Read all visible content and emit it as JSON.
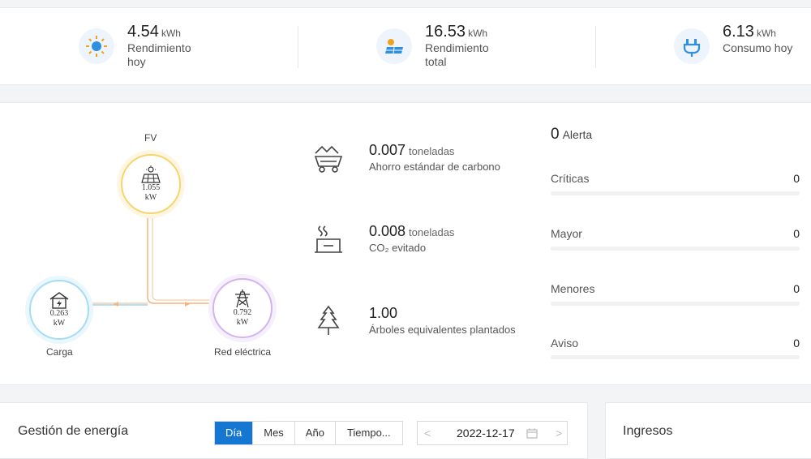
{
  "summary": [
    {
      "value": "4.54",
      "unit": "kWh",
      "label": "Rendimiento hoy",
      "icon": "sun-icon"
    },
    {
      "value": "16.53",
      "unit": "kWh",
      "label": "Rendimiento total",
      "icon": "solar-panel-sun-icon"
    },
    {
      "value": "6.13",
      "unit": "kWh",
      "label": "Consumo hoy",
      "icon": "plug-icon"
    }
  ],
  "flow": {
    "pv": {
      "label": "FV",
      "value": "1.055",
      "unit": "kW"
    },
    "load": {
      "label": "Carga",
      "value": "0.263",
      "unit": "kW"
    },
    "grid": {
      "label": "Red eléctrica",
      "value": "0.792",
      "unit": "kW"
    }
  },
  "environment": [
    {
      "value": "0.007",
      "unit": "toneladas",
      "label": "Ahorro estándar de carbono",
      "icon": "coal-cart-icon"
    },
    {
      "value": "0.008",
      "unit": "toneladas",
      "label": "CO₂ evitado",
      "icon": "factory-icon"
    },
    {
      "value": "1.00",
      "unit": "",
      "label": "Árboles equivalentes plantados",
      "icon": "tree-icon"
    }
  ],
  "alerts": {
    "count": "0",
    "title": "Alerta",
    "rows": [
      {
        "name": "Críticas",
        "count": "0"
      },
      {
        "name": "Mayor",
        "count": "0"
      },
      {
        "name": "Menores",
        "count": "0"
      },
      {
        "name": "Aviso",
        "count": "0"
      }
    ]
  },
  "energy": {
    "title": "Gestión de energía",
    "tabs": [
      "Día",
      "Mes",
      "Año",
      "Tiempo..."
    ],
    "active_tab": "Día",
    "date": "2022-12-17",
    "prev": "<",
    "next": ">"
  },
  "income": {
    "title": "Ingresos"
  },
  "colors": {
    "accent": "#1677d2",
    "pv": "#f5c344",
    "load": "#7cc8f0",
    "grid": "#c9a6e8",
    "flow_line": "#f6b27c"
  }
}
